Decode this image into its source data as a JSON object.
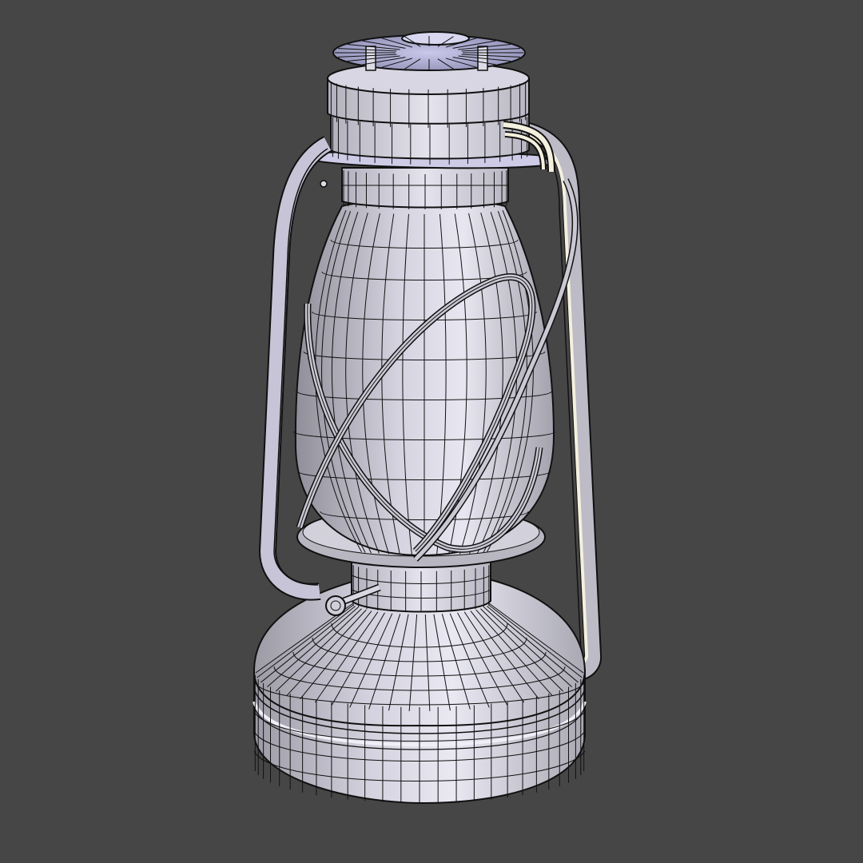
{
  "viewport": {
    "background": "#464646",
    "shading": "solid-wireframe",
    "object_name": "kerosene-lantern"
  },
  "colors": {
    "mesh_light": "#e6e5f2",
    "mesh_mid": "#bebdca",
    "mesh_dark": "#85848f",
    "wire": "#111111",
    "frame_highlight": "#f3f0de"
  }
}
